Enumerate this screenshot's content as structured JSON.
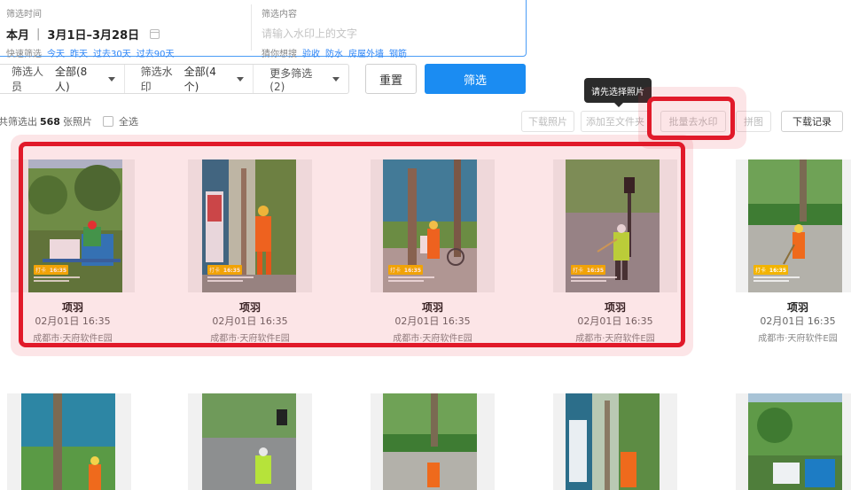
{
  "filter": {
    "time_caption": "筛选时间",
    "time_value": "本月",
    "time_range": "3月1日–3月28日",
    "quick_label": "快速筛选",
    "quick_options": [
      "今天",
      "昨天",
      "过去30天",
      "过去90天"
    ],
    "content_caption": "筛选内容",
    "content_placeholder": "请输入水印上的文字",
    "guess_label": "猜你想搜",
    "guess_options": [
      "验收",
      "防水",
      "房屋外墙",
      "钢筋"
    ]
  },
  "selectors": [
    {
      "label": "筛选人员",
      "value": "全部(8人)"
    },
    {
      "label": "筛选水印",
      "value": "全部(4个)"
    },
    {
      "label": "更多筛选(2)",
      "value": ""
    }
  ],
  "buttons": {
    "reset": "重置",
    "filter": "筛选"
  },
  "tooltip": "请先选择照片",
  "summary": {
    "prefix": "共筛选出",
    "count": "568",
    "suffix": "张照片",
    "select_all": "全选"
  },
  "toolbar": {
    "download": "下载照片",
    "add_to_folder": "添加至文件夹",
    "batch_remove_watermark": "批量去水印",
    "collage": "拼图",
    "download_log": "下载记录"
  },
  "photos_row1": [
    {
      "name": "项羽",
      "date": "02月01日 16:35",
      "location": "成都市·天府软件E园",
      "stamp_time": "16:35"
    },
    {
      "name": "项羽",
      "date": "02月01日 16:35",
      "location": "成都市·天府软件E园",
      "stamp_time": "16:35"
    },
    {
      "name": "项羽",
      "date": "02月01日 16:35",
      "location": "成都市·天府软件E园",
      "stamp_time": "16:35"
    },
    {
      "name": "项羽",
      "date": "02月01日 16:35",
      "location": "成都市·天府软件E园",
      "stamp_time": "16:35"
    },
    {
      "name": "项羽",
      "date": "02月01日 16:35",
      "location": "成都市·天府软件E园",
      "stamp_time": "16:35"
    }
  ],
  "colors": {
    "accent": "#1b8cf2",
    "highlight": "#e11a2a",
    "link": "#2f86f6"
  }
}
